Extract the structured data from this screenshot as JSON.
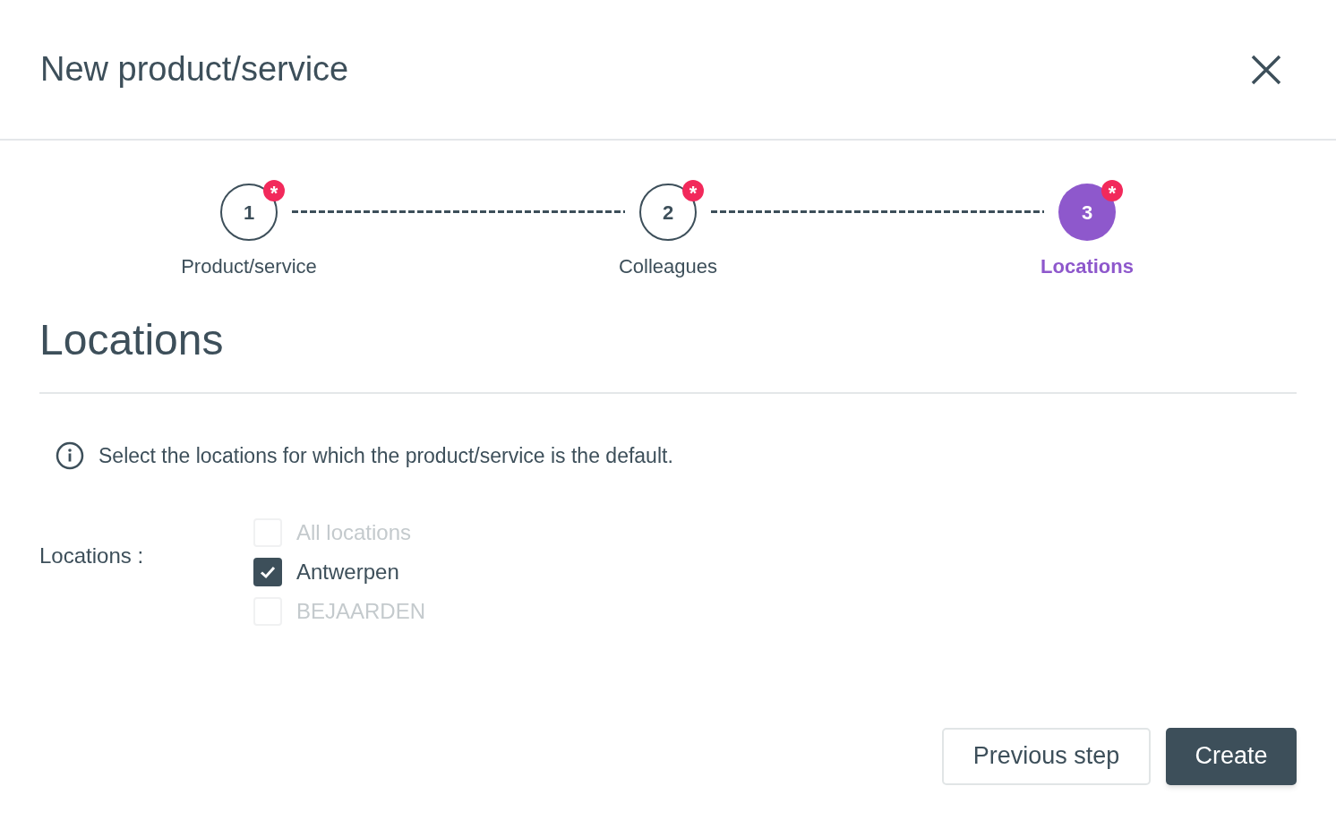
{
  "dialog": {
    "title": "New product/service"
  },
  "steps": [
    {
      "number": "1",
      "label": "Product/service",
      "required_mark": "*",
      "selected": false
    },
    {
      "number": "2",
      "label": "Colleagues",
      "required_mark": "*",
      "selected": false
    },
    {
      "number": "3",
      "label": "Locations",
      "required_mark": "*",
      "selected": true
    }
  ],
  "section": {
    "title": "Locations",
    "info": "Select the locations for which the product/service is the default."
  },
  "field": {
    "label": "Locations :",
    "options": [
      {
        "label": "All locations",
        "checked": false,
        "disabled": true
      },
      {
        "label": "Antwerpen",
        "checked": true,
        "disabled": false
      },
      {
        "label": "BEJAARDEN",
        "checked": false,
        "disabled": true
      }
    ]
  },
  "buttons": [
    {
      "label": "Previous step",
      "kind": "secondary"
    },
    {
      "label": "Create",
      "kind": "primary"
    }
  ]
}
